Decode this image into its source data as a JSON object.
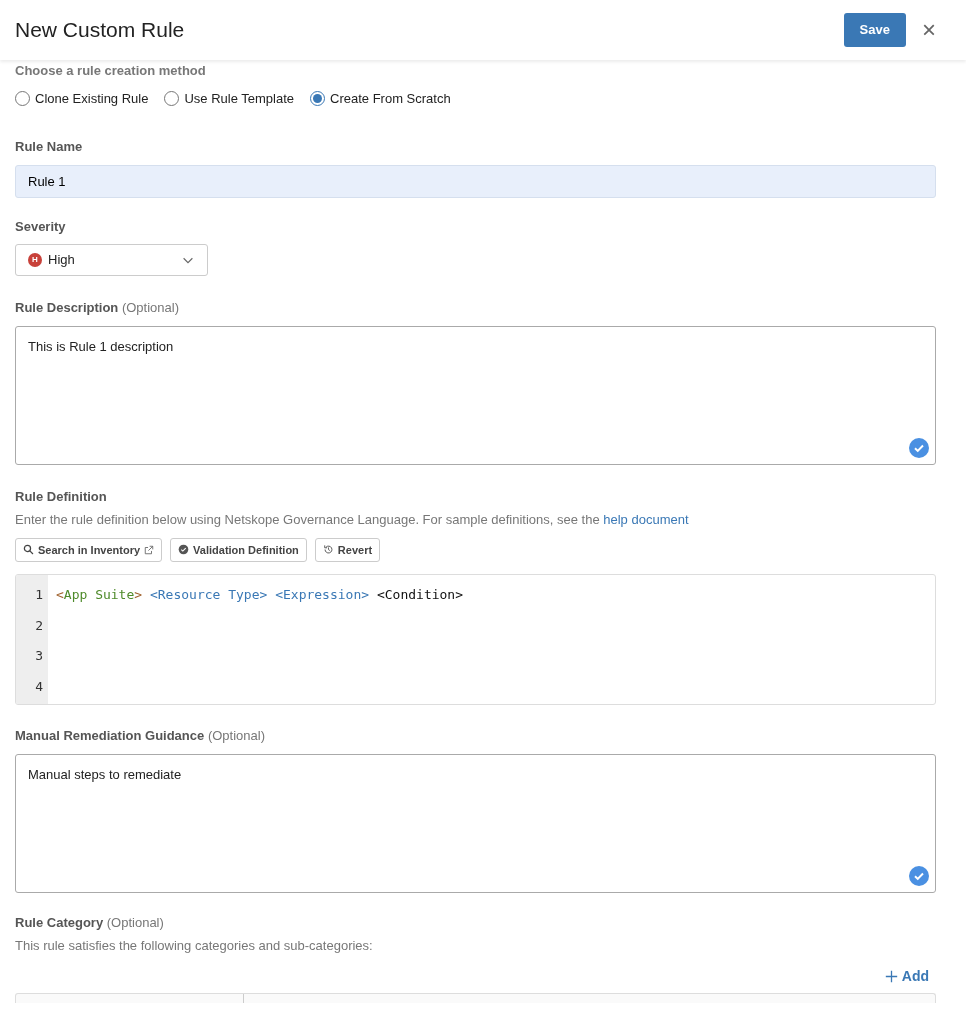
{
  "header": {
    "title": "New Custom Rule",
    "save": "Save",
    "close": "×"
  },
  "method": {
    "label": "Choose a rule creation method",
    "options": [
      {
        "label": "Clone Existing Rule",
        "selected": false
      },
      {
        "label": "Use Rule Template",
        "selected": false
      },
      {
        "label": "Create From Scratch",
        "selected": true
      }
    ]
  },
  "rule_name": {
    "label": "Rule Name",
    "value": "Rule 1"
  },
  "severity": {
    "label": "Severity",
    "badge": "H",
    "value": "High",
    "color": "#c8413a"
  },
  "description": {
    "label": "Rule Description",
    "optional": "(Optional)",
    "value": "This is Rule 1 description",
    "valid": true
  },
  "definition": {
    "label": "Rule Definition",
    "help": "Enter the rule definition below using Netskope Governance Language. For sample definitions, see the",
    "link": "help document",
    "buttons": [
      {
        "kind": "search",
        "label": "Search in Inventory"
      },
      {
        "kind": "validate",
        "label": "Validation Definition"
      },
      {
        "kind": "revert",
        "label": "Revert"
      }
    ],
    "lines": [
      {
        "number": "1",
        "tokens": [
          {
            "text": "<",
            "kind": "punct"
          },
          {
            "text": "App Suite",
            "kind": "suite"
          },
          {
            "text": ">",
            "kind": "punct"
          },
          {
            "text": " <Resource Type> <Expression>",
            "kind": "type"
          },
          {
            "text": " <Condition>",
            "kind": "plain"
          }
        ]
      },
      {
        "number": "2"
      },
      {
        "number": "3"
      },
      {
        "number": "4"
      }
    ]
  },
  "remediation": {
    "label": "Manual Remediation Guidance",
    "optional": "(Optional)",
    "value": "Manual steps to remediate",
    "valid": true
  },
  "category": {
    "label": "Rule Category",
    "optional": "(Optional)",
    "help": "This rule satisfies the following categories and sub-categories:",
    "add": "Add"
  }
}
